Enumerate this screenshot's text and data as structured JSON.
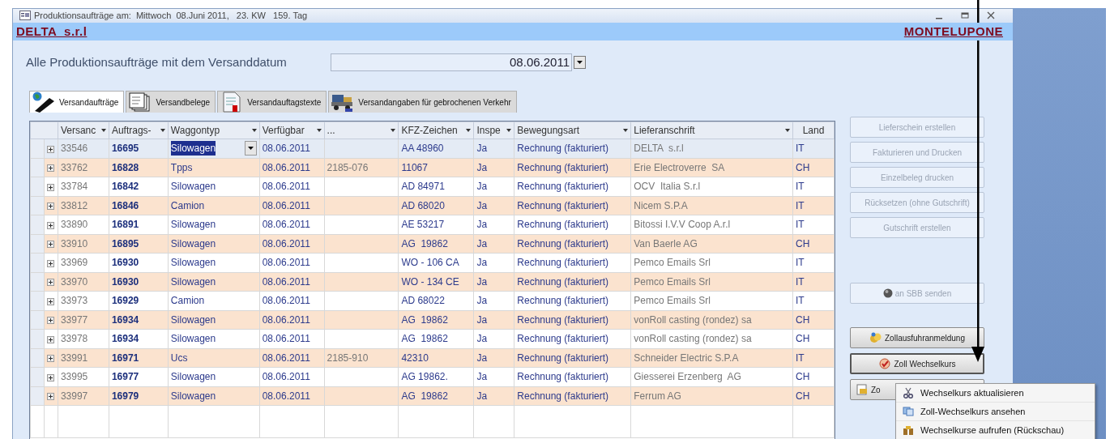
{
  "window": {
    "title": "Produktionsaufträge am:  Mittwoch  08.Juni 2011,   23. KW   159. Tag"
  },
  "header": {
    "company": "DELTA  s.r.l",
    "location": "MONTELUPONE"
  },
  "filter": {
    "label": "Alle Produktionsaufträge mit dem Versanddatum",
    "date": "08.06.2011"
  },
  "tabs": [
    {
      "label": "Versandaufträge",
      "selected": true
    },
    {
      "label": "Versandbelege",
      "selected": false
    },
    {
      "label": "Versandauftagstexte",
      "selected": false
    },
    {
      "label": "Versandangaben für gebrochenen Verkehr",
      "selected": false
    }
  ],
  "table": {
    "columns": [
      {
        "label": "Versanc",
        "filter": true
      },
      {
        "label": "Auftrags-",
        "filter": true
      },
      {
        "label": "Waggontyp",
        "filter": true
      },
      {
        "label": "Verfügbar",
        "filter": true
      },
      {
        "label": "...",
        "filter": true
      },
      {
        "label": "KFZ-Zeichen",
        "filter": true
      },
      {
        "label": "Inspe",
        "filter": true
      },
      {
        "label": "Bewegungsart",
        "filter": true
      },
      {
        "label": "Lieferanschrift",
        "filter": true
      },
      {
        "label": "Land",
        "filter": false
      }
    ],
    "rows": [
      {
        "selected": true,
        "cells": {
          "versand": "33546",
          "auftrag": "16695",
          "waggontyp": "Silowagen",
          "verfuegbar": "08.06.2011",
          "kfz": "AA 48960",
          "inspektion": "Ja",
          "bewegungsart": "Rechnung (fakturiert)",
          "lieferanschrift": "DELTA  s.r.l",
          "land": "IT"
        }
      },
      {
        "selected": false,
        "cells": {
          "versand": "33762",
          "auftrag": "16828",
          "waggontyp": "Tpps",
          "verfuegbar": "08.06.2011",
          "column_5": "2185-076",
          "kfz": "11067",
          "inspektion": "Ja",
          "bewegungsart": "Rechnung (fakturiert)",
          "lieferanschrift": "Erie Electroverre  SA",
          "land": "CH"
        }
      },
      {
        "selected": false,
        "cells": {
          "versand": "33784",
          "auftrag": "16842",
          "waggontyp": "Silowagen",
          "verfuegbar": "08.06.2011",
          "kfz": "AD 84971",
          "inspektion": "Ja",
          "bewegungsart": "Rechnung (fakturiert)",
          "lieferanschrift": "OCV  Italia S.r.l",
          "land": "IT"
        }
      },
      {
        "selected": false,
        "cells": {
          "versand": "33812",
          "auftrag": "16846",
          "waggontyp": "Camion",
          "verfuegbar": "08.06.2011",
          "kfz": "AD 68020",
          "inspektion": "Ja",
          "bewegungsart": "Rechnung (fakturiert)",
          "lieferanschrift": "Nicem S.P.A",
          "land": "IT"
        }
      },
      {
        "selected": false,
        "cells": {
          "versand": "33890",
          "auftrag": "16891",
          "waggontyp": "Silowagen",
          "verfuegbar": "08.06.2011",
          "kfz": "AE 53217",
          "inspektion": "Ja",
          "bewegungsart": "Rechnung (fakturiert)",
          "lieferanschrift": "Bitossi I.V.V Coop A.r.l",
          "land": "IT"
        }
      },
      {
        "selected": false,
        "cells": {
          "versand": "33910",
          "auftrag": "16895",
          "waggontyp": "Silowagen",
          "verfuegbar": "08.06.2011",
          "kfz": "AG  19862",
          "inspektion": "Ja",
          "bewegungsart": "Rechnung (fakturiert)",
          "lieferanschrift": "Van Baerle AG",
          "land": "CH"
        }
      },
      {
        "selected": false,
        "cells": {
          "versand": "33969",
          "auftrag": "16930",
          "waggontyp": "Silowagen",
          "verfuegbar": "08.06.2011",
          "kfz": "WO - 106 CA",
          "inspektion": "Ja",
          "bewegungsart": "Rechnung (fakturiert)",
          "lieferanschrift": "Pemco Emails Srl",
          "land": "IT"
        }
      },
      {
        "selected": false,
        "cells": {
          "versand": "33970",
          "auftrag": "16930",
          "waggontyp": "Silowagen",
          "verfuegbar": "08.06.2011",
          "kfz": "WO - 134 CE",
          "inspektion": "Ja",
          "bewegungsart": "Rechnung (fakturiert)",
          "lieferanschrift": "Pemco Emails Srl",
          "land": "IT"
        }
      },
      {
        "selected": false,
        "cells": {
          "versand": "33973",
          "auftrag": "16929",
          "waggontyp": "Camion",
          "verfuegbar": "08.06.2011",
          "kfz": "AD 68022",
          "inspektion": "Ja",
          "bewegungsart": "Rechnung (fakturiert)",
          "lieferanschrift": "Pemco Emails Srl",
          "land": "IT"
        }
      },
      {
        "selected": false,
        "cells": {
          "versand": "33977",
          "auftrag": "16934",
          "waggontyp": "Silowagen",
          "verfuegbar": "08.06.2011",
          "kfz": "AG  19862",
          "inspektion": "Ja",
          "bewegungsart": "Rechnung (fakturiert)",
          "lieferanschrift": "vonRoll casting (rondez) sa",
          "land": "CH"
        }
      },
      {
        "selected": false,
        "cells": {
          "versand": "33978",
          "auftrag": "16934",
          "waggontyp": "Silowagen",
          "verfuegbar": "08.06.2011",
          "kfz": "AG  19862",
          "inspektion": "Ja",
          "bewegungsart": "Rechnung (fakturiert)",
          "lieferanschrift": "vonRoll casting (rondez) sa",
          "land": "CH"
        }
      },
      {
        "selected": false,
        "cells": {
          "versand": "33991",
          "auftrag": "16971",
          "waggontyp": "Ucs",
          "verfuegbar": "08.06.2011",
          "column_5": "2185-910",
          "kfz": "42310",
          "inspektion": "Ja",
          "bewegungsart": "Rechnung (fakturiert)",
          "lieferanschrift": "Schneider Electric S.P.A",
          "land": "IT"
        }
      },
      {
        "selected": false,
        "cells": {
          "versand": "33995",
          "auftrag": "16977",
          "waggontyp": "Silowagen",
          "verfuegbar": "08.06.2011",
          "kfz": "AG 19862.",
          "inspektion": "Ja",
          "bewegungsart": "Rechnung (fakturiert)",
          "lieferanschrift": "Giesserei Erzenberg  AG",
          "land": "CH"
        }
      },
      {
        "selected": false,
        "cells": {
          "versand": "33997",
          "auftrag": "16979",
          "waggontyp": "Silowagen",
          "verfuegbar": "08.06.2011",
          "kfz": "AG  19862",
          "inspektion": "Ja",
          "bewegungsart": "Rechnung (fakturiert)",
          "lieferanschrift": "Ferrum AG",
          "land": "CH"
        }
      }
    ]
  },
  "button_groups": [
    [
      {
        "label": "Lieferschein erstellen",
        "kind": "plain",
        "disabled": true,
        "pressed": false
      },
      {
        "label": "Fakturieren und Drucken",
        "kind": "plain",
        "disabled": true,
        "pressed": false
      },
      {
        "label": "Einzelbeleg drucken",
        "kind": "plain",
        "disabled": true,
        "pressed": false
      },
      {
        "label": "Rücksetzen (ohne Gutschrift)",
        "kind": "plain",
        "disabled": true,
        "pressed": false
      },
      {
        "label": "Gutschrift erstellen",
        "kind": "plain",
        "disabled": true,
        "pressed": false
      }
    ],
    [
      {
        "label": "an SBB senden",
        "kind": "sphere",
        "disabled": true,
        "pressed": false
      }
    ],
    [
      {
        "label": "Zollausfuhranmeldung",
        "kind": "customs",
        "disabled": false,
        "pressed": false
      },
      {
        "label": "Zoll Wechselkurs",
        "kind": "rate",
        "disabled": false,
        "pressed": true
      },
      {
        "label": "Zo",
        "kind": "document",
        "disabled": false,
        "pressed": false
      }
    ]
  ],
  "context_menu": [
    {
      "label": "Wechselkurs aktualisieren",
      "kind": "tool"
    },
    {
      "label": "Zoll-Wechselkurs ansehen",
      "kind": "copy"
    },
    {
      "label": "Wechselkurse aufrufen (Rückschau)",
      "kind": "binoculars"
    }
  ]
}
